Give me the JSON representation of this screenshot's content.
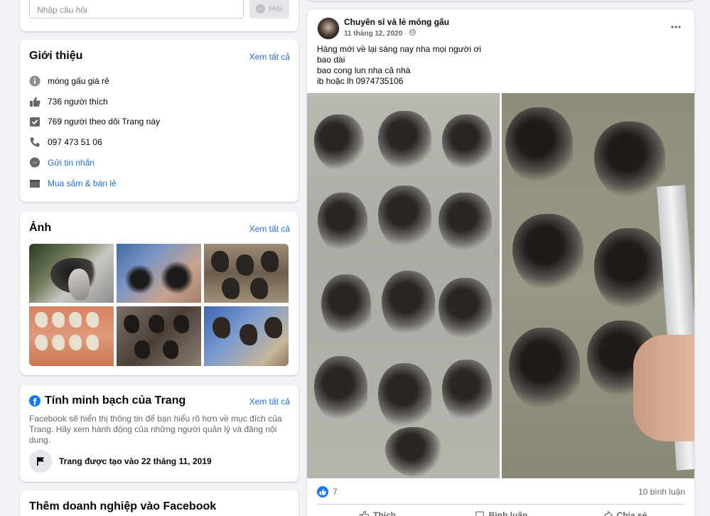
{
  "ask_box": {
    "placeholder": "Nhập câu hỏi",
    "button_label": "Hỏi"
  },
  "intro": {
    "title": "Giới thiệu",
    "see_all": "Xem tất cả",
    "items": [
      {
        "icon": "info-icon",
        "text": "móng gấu giá rẻ"
      },
      {
        "icon": "like-icon",
        "text": "736 người thích"
      },
      {
        "icon": "follow-check-icon",
        "text": "769 người theo dõi Trang này"
      },
      {
        "icon": "phone-icon",
        "text": "097 473 51 06"
      },
      {
        "icon": "messenger-icon",
        "text": "Gửi tin nhắn"
      },
      {
        "icon": "shop-icon",
        "text": "Mua sắm & bán lẻ"
      }
    ]
  },
  "photos": {
    "title": "Ảnh",
    "see_all": "Xem tất cả"
  },
  "transparency": {
    "title": "Tính minh bạch của Trang",
    "see_all": "Xem tất cả",
    "description": "Facebook sẽ hiển thị thông tin để bạn hiểu rõ hơn về mục đích của Trang. Hãy xem hành động của những người quản lý và đăng nội dung.",
    "created": "Trang được tạo vào 22 tháng 11, 2019"
  },
  "add_business": {
    "title": "Thêm doanh nghiệp vào Facebook"
  },
  "post": {
    "author": "Chuyên sỉ và lẻ móng gấu",
    "date": "11 tháng 12, 2020",
    "lines": [
      "Hàng mới về lại sáng nay nha mọi người ơi",
      "bao dài",
      "bao cong lun nha cả nhà",
      "ib hoặc lh 0974735106"
    ],
    "reactions": "7",
    "comments": "10 bình luận",
    "actions": {
      "like": "Thích",
      "comment": "Bình luận",
      "share": "Chia sẻ"
    }
  },
  "colors": {
    "accent": "#216fdb",
    "background": "#f0f2f5",
    "like_blue": "#1877f2"
  }
}
